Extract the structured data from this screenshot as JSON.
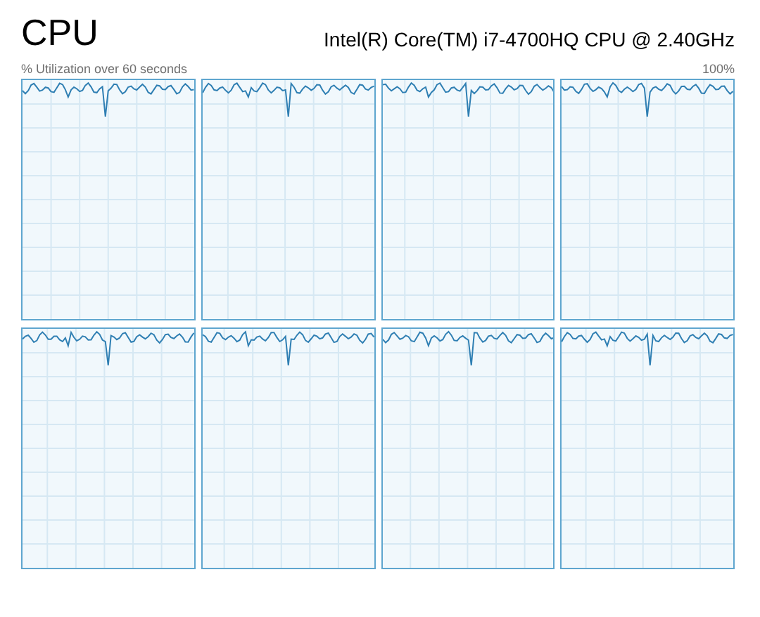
{
  "title": "CPU",
  "processor_name": "Intel(R) Core(TM) i7-4700HQ CPU @ 2.40GHz",
  "graph_caption": "% Utilization over 60 seconds",
  "graph_max_label": "100%"
}
